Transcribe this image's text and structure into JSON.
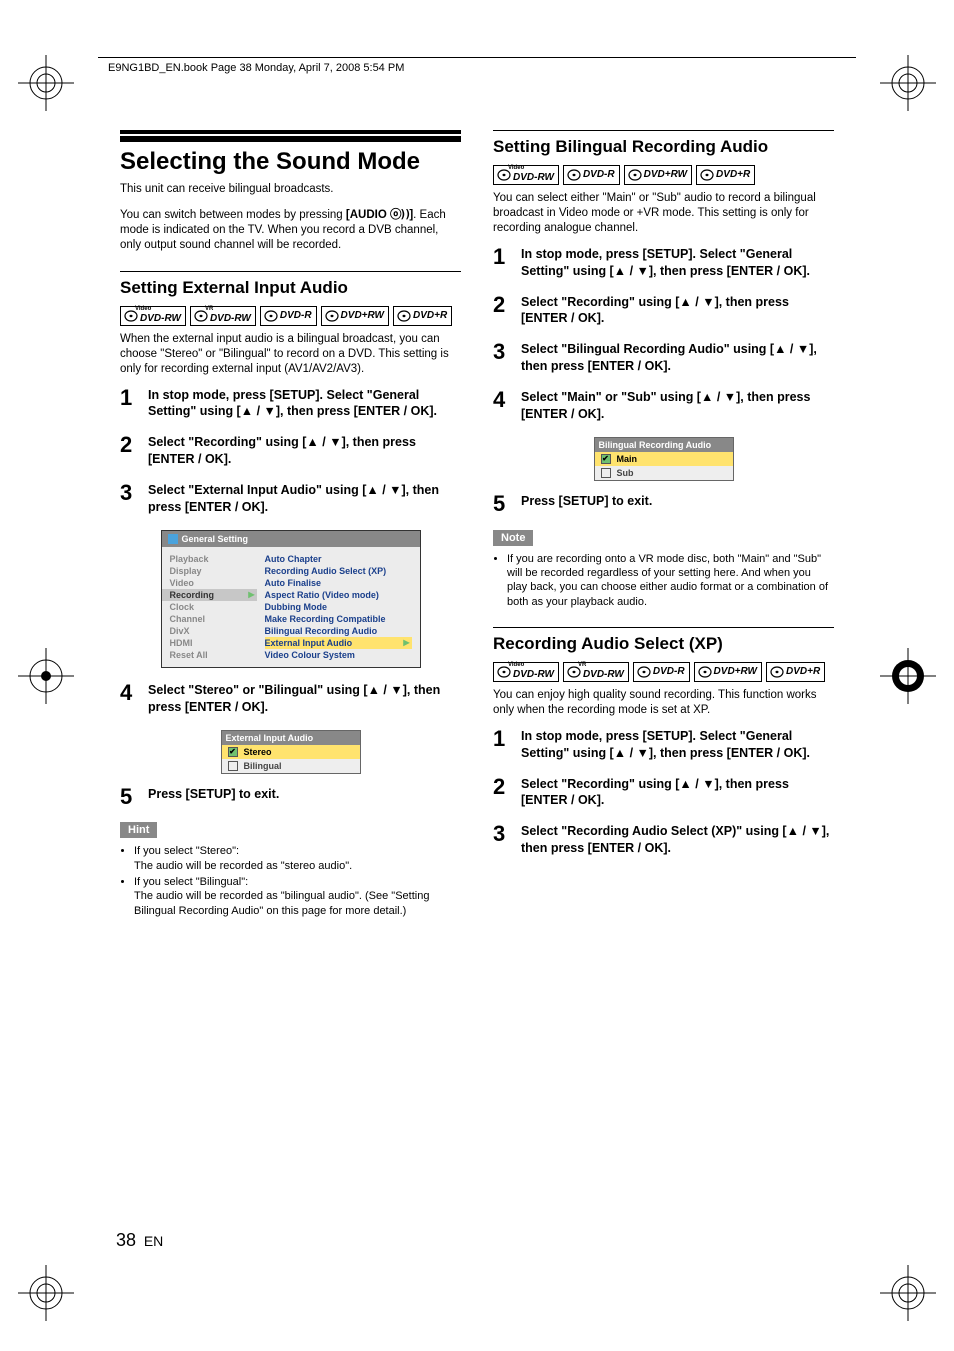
{
  "header": {
    "running_head": "E9NG1BD_EN.book  Page 38  Monday, April 7, 2008  5:54 PM"
  },
  "page": {
    "number": "38",
    "lang": "EN"
  },
  "left_col": {
    "main_title": "Selecting the Sound Mode",
    "intro1": "This unit can receive bilingual broadcasts.",
    "intro2_pre": "You can switch between modes by pressing ",
    "intro2_key": "[AUDIO ",
    "intro2_icon": "ⓞ))",
    "intro2_key_close": "]",
    "intro2_post": ". Each mode is indicated on the TV. When you record a DVB channel, only output sound channel will be recorded.",
    "sub1": "Setting External Input Audio",
    "discs1": [
      "DVD-RW|Video",
      "DVD-RW|VR",
      "DVD-R",
      "DVD+RW",
      "DVD+R"
    ],
    "sub1_body": "When the external input audio is a bilingual broadcast, you can choose \"Stereo\" or \"Bilingual\" to record on a DVD. This setting is only for recording external input (AV1/AV2/AV3).",
    "steps1": [
      "In stop mode, press [SETUP]. Select \"General Setting\" using [▲ / ▼], then press [ENTER / OK].",
      "Select \"Recording\" using [▲ / ▼], then press [ENTER / OK].",
      "Select \"External Input Audio\" using [▲ / ▼], then press [ENTER / OK].",
      "Select \"Stereo\" or \"Bilingual\" using [▲ / ▼], then press [ENTER / OK].",
      "Press [SETUP] to exit."
    ],
    "menu": {
      "title": "General Setting",
      "left": [
        "Playback",
        "Display",
        "Video",
        "Recording",
        "Clock",
        "Channel",
        "DivX",
        "HDMI",
        "Reset All"
      ],
      "selected_left_index": 3,
      "right": [
        "Auto Chapter",
        "Recording Audio Select (XP)",
        "Auto Finalise",
        "Aspect Ratio (Video mode)",
        "Dubbing Mode",
        "Make Recording Compatible",
        "Bilingual Recording Audio",
        "External Input Audio",
        "Video Colour System"
      ],
      "highlighted_right_index": 7
    },
    "small_menu1": {
      "title": "External Input Audio",
      "rows": [
        "Stereo",
        "Bilingual"
      ],
      "selected_index": 0
    },
    "hint_label": "Hint",
    "hints": [
      {
        "head": "If you select \"Stereo\":",
        "body": "The audio will be recorded as \"stereo audio\"."
      },
      {
        "head": "If you select \"Bilingual\":",
        "body": "The audio will be recorded as \"bilingual audio\". (See \"Setting Bilingual Recording Audio\" on this page for more detail.)"
      }
    ]
  },
  "right_col": {
    "sub2": "Setting Bilingual Recording Audio",
    "discs2": [
      "DVD-RW|Video",
      "DVD-R",
      "DVD+RW",
      "DVD+R"
    ],
    "sub2_body": "You can select either \"Main\" or \"Sub\" audio to record a bilingual broadcast in Video mode or +VR mode. This setting is only for recording analogue channel.",
    "steps2": [
      "In stop mode, press [SETUP]. Select \"General Setting\" using [▲ / ▼], then press [ENTER / OK].",
      "Select \"Recording\" using [▲ / ▼], then press [ENTER / OK].",
      "Select \"Bilingual Recording Audio\" using [▲ / ▼], then press [ENTER / OK].",
      "Select \"Main\" or \"Sub\" using [▲ / ▼], then press [ENTER / OK].",
      "Press [SETUP] to exit."
    ],
    "small_menu2": {
      "title": "Bilingual Recording Audio",
      "rows": [
        "Main",
        "Sub"
      ],
      "selected_index": 0
    },
    "note_label": "Note",
    "note_body": "If you are recording onto a VR mode disc, both \"Main\" and \"Sub\" will be recorded regardless of your setting here. And when you play back, you can choose either audio format or a combination of both as your playback audio.",
    "sub3": "Recording Audio Select (XP)",
    "discs3": [
      "DVD-RW|Video",
      "DVD-RW|VR",
      "DVD-R",
      "DVD+RW",
      "DVD+R"
    ],
    "sub3_body": "You can enjoy high quality sound recording. This function works only when the recording mode is set at XP.",
    "steps3": [
      "In stop mode, press [SETUP]. Select \"General Setting\" using [▲ / ▼], then press [ENTER / OK].",
      "Select \"Recording\" using [▲ / ▼], then press [ENTER / OK].",
      "Select \"Recording Audio Select (XP)\" using [▲ / ▼], then press [ENTER / OK]."
    ]
  }
}
